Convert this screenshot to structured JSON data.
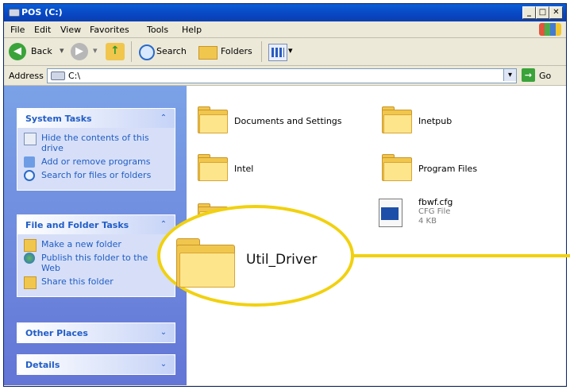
{
  "window": {
    "title": "POS (C:)",
    "controls": {
      "minimize": "_",
      "maximize": "□",
      "close": "✕"
    }
  },
  "menubar": {
    "items": [
      "File",
      "Edit",
      "View",
      "Favorites",
      "Tools",
      "Help"
    ]
  },
  "toolbar": {
    "back_label": "Back",
    "search_label": "Search",
    "folders_label": "Folders"
  },
  "address": {
    "label": "Address",
    "value": "C:\\",
    "go_label": "Go"
  },
  "left_pane": {
    "system_tasks": {
      "title": "System Tasks",
      "items": [
        {
          "label": "Hide the contents of this drive",
          "icon": "hide-drive-icon"
        },
        {
          "label": "Add or remove programs",
          "icon": "add-remove-programs-icon"
        },
        {
          "label": "Search for files or folders",
          "icon": "search-icon"
        }
      ]
    },
    "file_folder_tasks": {
      "title": "File and Folder Tasks",
      "items": [
        {
          "label": "Make a new folder",
          "icon": "new-folder-icon"
        },
        {
          "label": "Publish this folder to the Web",
          "icon": "publish-web-icon"
        },
        {
          "label": "Share this folder",
          "icon": "share-folder-icon"
        }
      ]
    },
    "other_places": {
      "title": "Other Places"
    },
    "details": {
      "title": "Details"
    }
  },
  "content": {
    "items": [
      {
        "name": "Documents and Settings",
        "type": "folder"
      },
      {
        "name": "Inetpub",
        "type": "folder"
      },
      {
        "name": "Intel",
        "type": "folder"
      },
      {
        "name": "Program Files",
        "type": "folder"
      },
      {
        "name": "fbwf.cfg",
        "type": "file",
        "kind": "CFG File",
        "size": "4 KB"
      }
    ],
    "callout": {
      "name": "Util_Driver"
    }
  },
  "colors": {
    "titlebar": "#0846c2",
    "task_pane": "#6375d6",
    "callout": "#f1d10f",
    "folder": "#f1c64d"
  }
}
